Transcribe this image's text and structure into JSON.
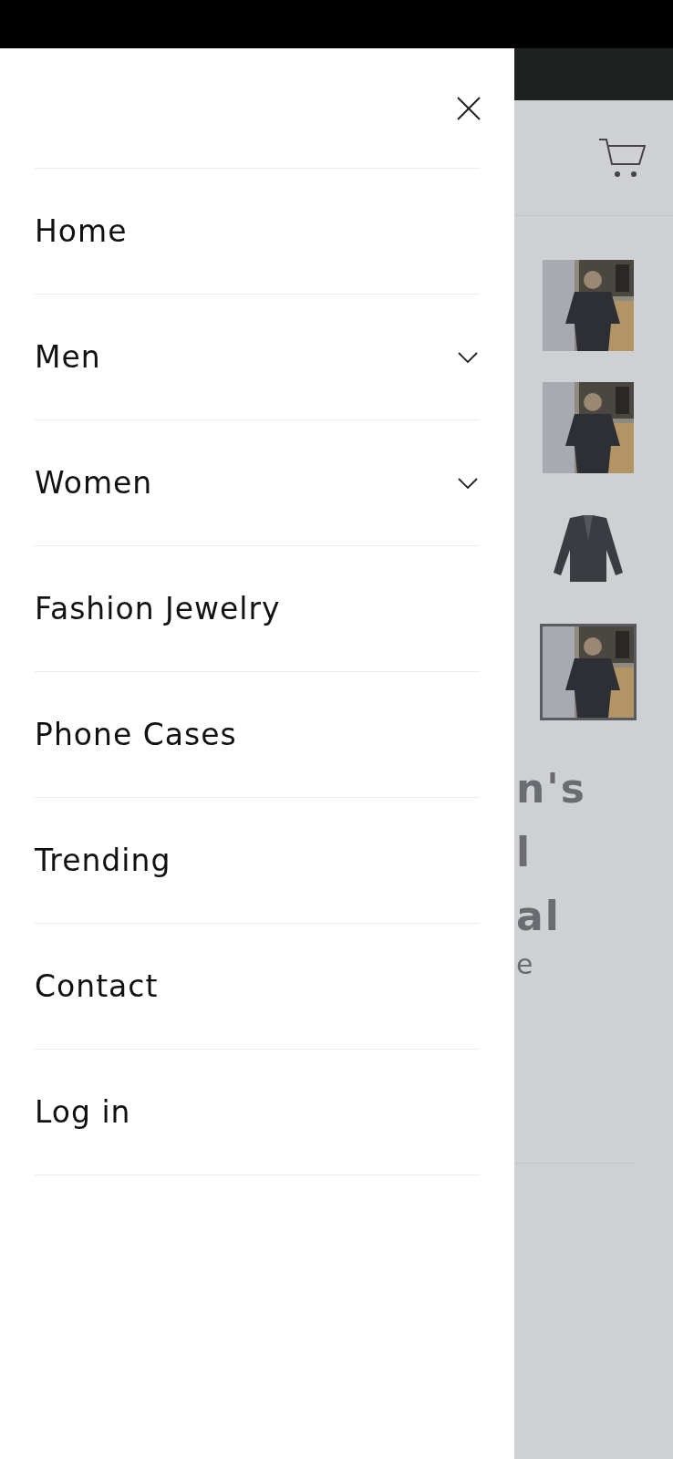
{
  "menu": {
    "items": [
      {
        "label": "Home",
        "expandable": false
      },
      {
        "label": "Men",
        "expandable": true
      },
      {
        "label": "Women",
        "expandable": true
      },
      {
        "label": "Fashion Jewelry",
        "expandable": false
      },
      {
        "label": "Phone Cases",
        "expandable": false
      },
      {
        "label": "Trending",
        "expandable": false
      },
      {
        "label": "Contact",
        "expandable": false
      },
      {
        "label": "Log in",
        "expandable": false
      }
    ]
  },
  "background": {
    "thumbnails": [
      {
        "kind": "picture",
        "selected": false
      },
      {
        "kind": "picture",
        "selected": false
      },
      {
        "kind": "picture",
        "selected": false
      },
      {
        "kind": "picture",
        "selected": true
      }
    ],
    "title_fragments": [
      "n's",
      "l",
      "al"
    ],
    "text_fragment": "e"
  }
}
